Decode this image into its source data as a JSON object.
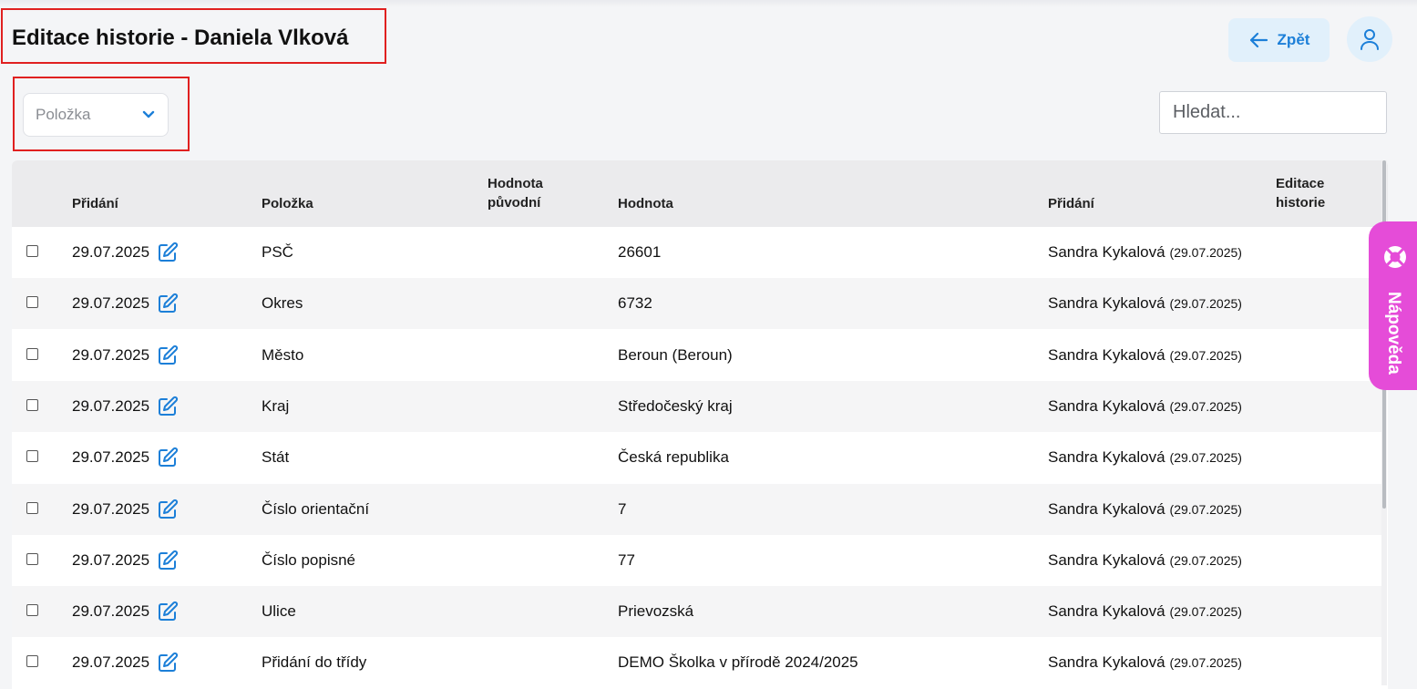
{
  "header": {
    "title": "Editace historie - Daniela Vlková",
    "back_label": "Zpět"
  },
  "filter": {
    "selected": "Položka"
  },
  "search": {
    "placeholder": "Hledat..."
  },
  "table": {
    "headers": {
      "added": "Přidání",
      "item": "Položka",
      "original_value_1": "Hodnota",
      "original_value_2": "původní",
      "value": "Hodnota",
      "added_by": "Přidání",
      "edit_history_1": "Editace",
      "edit_history_2": "historie"
    },
    "rows": [
      {
        "date": "29.07.2025",
        "item": "PSČ",
        "original": "",
        "value": "26601",
        "user": "Sandra Kykalová",
        "user_date": "(29.07.2025)"
      },
      {
        "date": "29.07.2025",
        "item": "Okres",
        "original": "",
        "value": "6732",
        "user": "Sandra Kykalová",
        "user_date": "(29.07.2025)"
      },
      {
        "date": "29.07.2025",
        "item": "Město",
        "original": "",
        "value": "Beroun (Beroun)",
        "user": "Sandra Kykalová",
        "user_date": "(29.07.2025)"
      },
      {
        "date": "29.07.2025",
        "item": "Kraj",
        "original": "",
        "value": "Středočeský kraj",
        "user": "Sandra Kykalová",
        "user_date": "(29.07.2025)"
      },
      {
        "date": "29.07.2025",
        "item": "Stát",
        "original": "",
        "value": "Česká republika",
        "user": "Sandra Kykalová",
        "user_date": "(29.07.2025)"
      },
      {
        "date": "29.07.2025",
        "item": "Číslo orientační",
        "original": "",
        "value": "7",
        "user": "Sandra Kykalová",
        "user_date": "(29.07.2025)"
      },
      {
        "date": "29.07.2025",
        "item": "Číslo popisné",
        "original": "",
        "value": "77",
        "user": "Sandra Kykalová",
        "user_date": "(29.07.2025)"
      },
      {
        "date": "29.07.2025",
        "item": "Ulice",
        "original": "",
        "value": "Prievozská",
        "user": "Sandra Kykalová",
        "user_date": "(29.07.2025)"
      },
      {
        "date": "29.07.2025",
        "item": "Přidání do třídy",
        "original": "",
        "value": "DEMO Školka v přírodě 2024/2025",
        "user": "Sandra Kykalová",
        "user_date": "(29.07.2025)"
      }
    ]
  },
  "help": {
    "label": "Nápověda"
  },
  "colors": {
    "accent": "#1c7fd8",
    "accent_bg": "#e1f0fb",
    "highlight_border": "#e02020",
    "help_tab": "#e54cd8"
  },
  "icons": {
    "back": "arrow-left-icon",
    "user": "user-icon",
    "dropdown": "chevron-down-icon",
    "edit": "edit-icon",
    "help": "lifebuoy-icon"
  }
}
